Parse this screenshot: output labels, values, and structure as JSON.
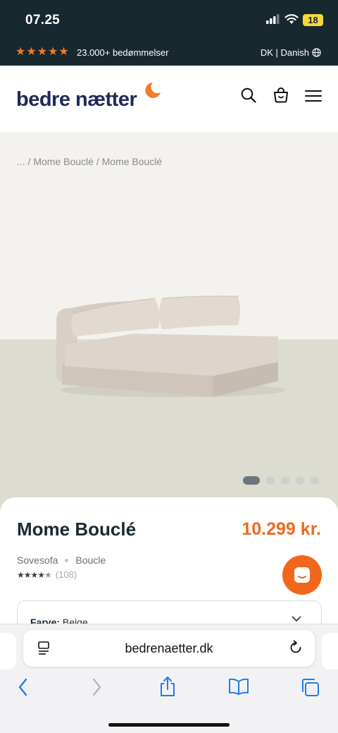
{
  "status": {
    "time": "07.25",
    "battery": "18"
  },
  "topbar": {
    "ratings": "23.000+ bedømmelser",
    "language": "DK | Danish"
  },
  "header": {
    "logo": "bedre nætter"
  },
  "breadcrumb": {
    "text": "... / Mome Bouclé / Mome Bouclé"
  },
  "carousel": {
    "total_slides": 5,
    "active_index": 0
  },
  "product": {
    "title": "Mome Bouclé",
    "price": "10.299 kr.",
    "category": "Sovesofa",
    "material": "Boucle",
    "rating_stars": 4.5,
    "review_count": "(108)",
    "color_label": "Farve:",
    "color_value": "Beige"
  },
  "browser": {
    "url": "bedrenaetter.dk"
  },
  "colors": {
    "dark": "#17282e",
    "brand_orange": "#ee6a1e",
    "logo_blue": "#1f2a5a",
    "ios_blue": "#1e7cf2"
  },
  "icons": [
    "signal-icon",
    "wifi-icon",
    "globe-icon",
    "moon-icon",
    "search-icon",
    "basket-icon",
    "menu-icon",
    "chat-icon",
    "chevron-down-icon",
    "reader-icon",
    "reload-icon",
    "back-icon",
    "forward-icon",
    "share-icon",
    "bookmarks-icon",
    "tabs-icon"
  ]
}
